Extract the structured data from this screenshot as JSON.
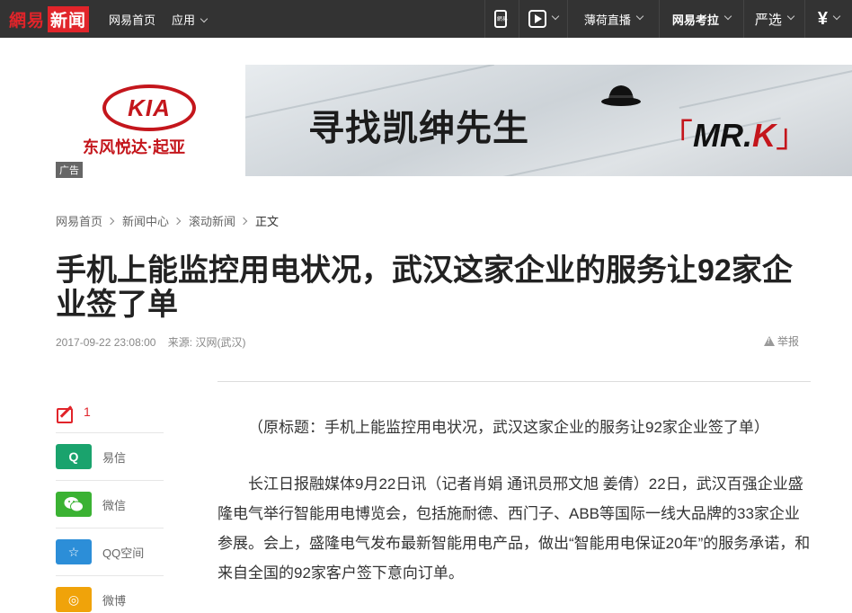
{
  "topbar": {
    "logo_part1": "網易",
    "logo_part2": "新闻",
    "nav": [
      "网易首页",
      "应用"
    ],
    "right": {
      "mobile_label": "網易",
      "live_label": "薄荷直播",
      "kaowei_label": "网易考拉",
      "yanxuan_label": "严选",
      "wallet_symbol": "¥"
    }
  },
  "ad": {
    "brand_logo": "KIA",
    "brand_cn": "东风悦达·起亚",
    "tag": "广告",
    "slogan": "寻找凯绅先生",
    "mrk_prefix": "MR.",
    "mrk_k": "K",
    "bracket_open": "「",
    "bracket_close": "」"
  },
  "breadcrumb": [
    "网易首页",
    "新闻中心",
    "滚动新闻",
    "正文"
  ],
  "article": {
    "title": "手机上能监控用电状况，武汉这家企业的服务让92家企业签了单",
    "time": "2017-09-22 23:08:00",
    "source": "来源: 汉网(武汉)",
    "report": "举报",
    "paragraphs": [
      "（原标题：手机上能监控用电状况，武汉这家企业的服务让92家企业签了单）",
      "长江日报融媒体9月22日讯（记者肖娟 通讯员邢文旭 姜倩）22日，武汉百强企业盛隆电气举行智能用电博览会，包括施耐德、西门子、ABB等国际一线大品牌的33家企业参展。会上，盛隆电气发布最新智能用电产品，做出“智能用电保证20年”的服务承诺，和来自全国的92家客户签下意向订单。"
    ]
  },
  "share": {
    "comment_count": "1",
    "items": [
      {
        "label": "易信",
        "badge": "Q",
        "color": "#1aa36d"
      },
      {
        "label": "微信",
        "badge": "✆",
        "color": "#3bb233"
      },
      {
        "label": "QQ空间",
        "badge": "☆",
        "color": "#2c8ed8"
      },
      {
        "label": "微博",
        "badge": "◎",
        "color": "#f0a30a"
      }
    ]
  }
}
